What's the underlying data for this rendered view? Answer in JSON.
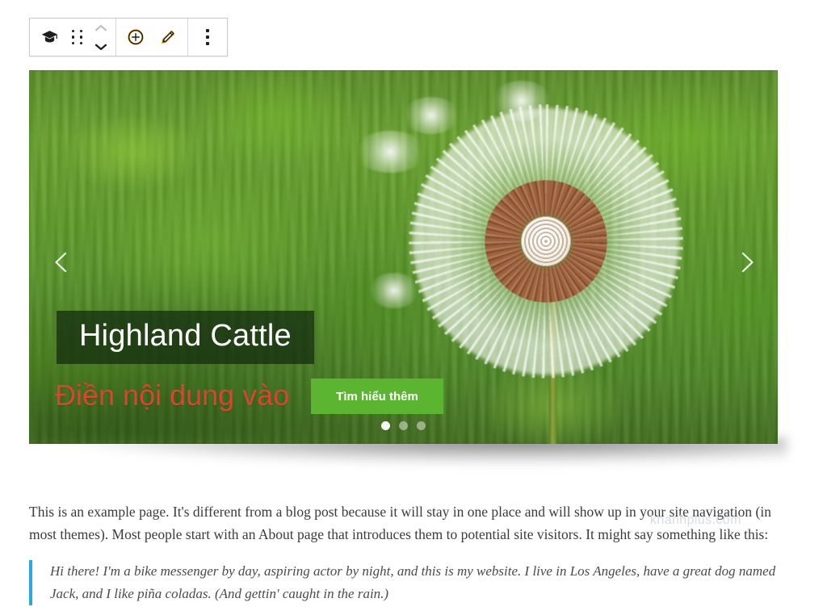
{
  "toolbar": {
    "block_type_icon": "graduation-cap-icon",
    "drag_handle_icon": "drag-handle-icon",
    "move_up_icon": "chevron-up-icon",
    "move_down_icon": "chevron-down-icon",
    "add_icon": "plus-circle-icon",
    "edit_icon": "pencil-icon",
    "more_icon": "vertical-ellipsis-icon",
    "accent_color": "#f0a500",
    "icon_color": "#1e1e1e",
    "disabled_color": "#b8b8b8",
    "border_color": "#c9c9c9"
  },
  "slider": {
    "prev_icon": "chevron-left-icon",
    "next_icon": "chevron-right-icon",
    "title": "Highland Cattle",
    "subtitle": "Điền nội dung vào",
    "subtitle_color": "#d8462f",
    "cta_label": "Tìm hiểu thêm",
    "cta_color": "#5cb531",
    "title_box_color": "rgba(16,38,14,0.70)",
    "dots": [
      {
        "label": "1",
        "active": true
      },
      {
        "label": "2",
        "active": false
      },
      {
        "label": "3",
        "active": false
      }
    ]
  },
  "content": {
    "paragraph": "This is an example page. It's different from a blog post because it will stay in one place and will show up in your site navigation (in most themes). Most people start with an About page that introduces them to potential site visitors. It might say something like this:",
    "watermark": "khanhplus.com",
    "blockquote": "Hi there! I'm a bike messenger by day, aspiring actor by night, and this is my website. I live in Los Angeles, have a great dog named Jack, and I like piña coladas. (And gettin' caught in the rain.)",
    "blockquote_border_color": "#29a8e0"
  }
}
